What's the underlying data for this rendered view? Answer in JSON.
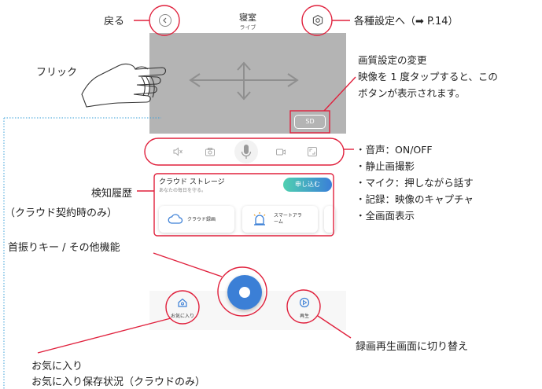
{
  "app": {
    "title": "寝室",
    "subtitle": "ライブ",
    "sd_label": "SD",
    "cloud": {
      "title": "クラウド ストレージ",
      "subtitle": "あなたの毎日を守る。",
      "apply_label": "申し込む",
      "cards": [
        {
          "label": "クラウド録画",
          "icon": "cloud-icon"
        },
        {
          "label": "スマートアラーム",
          "icon": "alarm-light-icon"
        }
      ]
    },
    "nav": {
      "favorites_label": "お気に入り",
      "playback_label": "再生"
    },
    "controls": [
      "mute-icon",
      "camera-icon",
      "microphone-icon",
      "record-icon",
      "fullscreen-icon"
    ]
  },
  "annotations": {
    "back": "戻る",
    "settings": "各種設定へ（➡ P.14）",
    "flick": "フリック",
    "quality_title": "画質設定の変更",
    "quality_line1": "映像を 1 度タップすると、この",
    "quality_line2": "ボタンが表示されます。",
    "controls_list": [
      "・音声：ON/OFF",
      "・静止画撮影",
      "・マイク：押しながら話す",
      "・記録：映像のキャプチャ",
      "・全画面表示"
    ],
    "detection_history": "検知履歴",
    "detection_note": "（クラウド契約時のみ）",
    "pan_key": "首振りキー / その他機能",
    "playback_switch": "録画再生画面に切り替え",
    "favorites": "お気に入り",
    "favorites_status": "お気に入り保存状況（クラウドのみ）"
  },
  "colors": {
    "accent_blue": "#3b7fd6",
    "annotation_red": "#e0203c",
    "video_gray": "#b4b4b4",
    "dotted_blue": "#3aa0d8"
  }
}
